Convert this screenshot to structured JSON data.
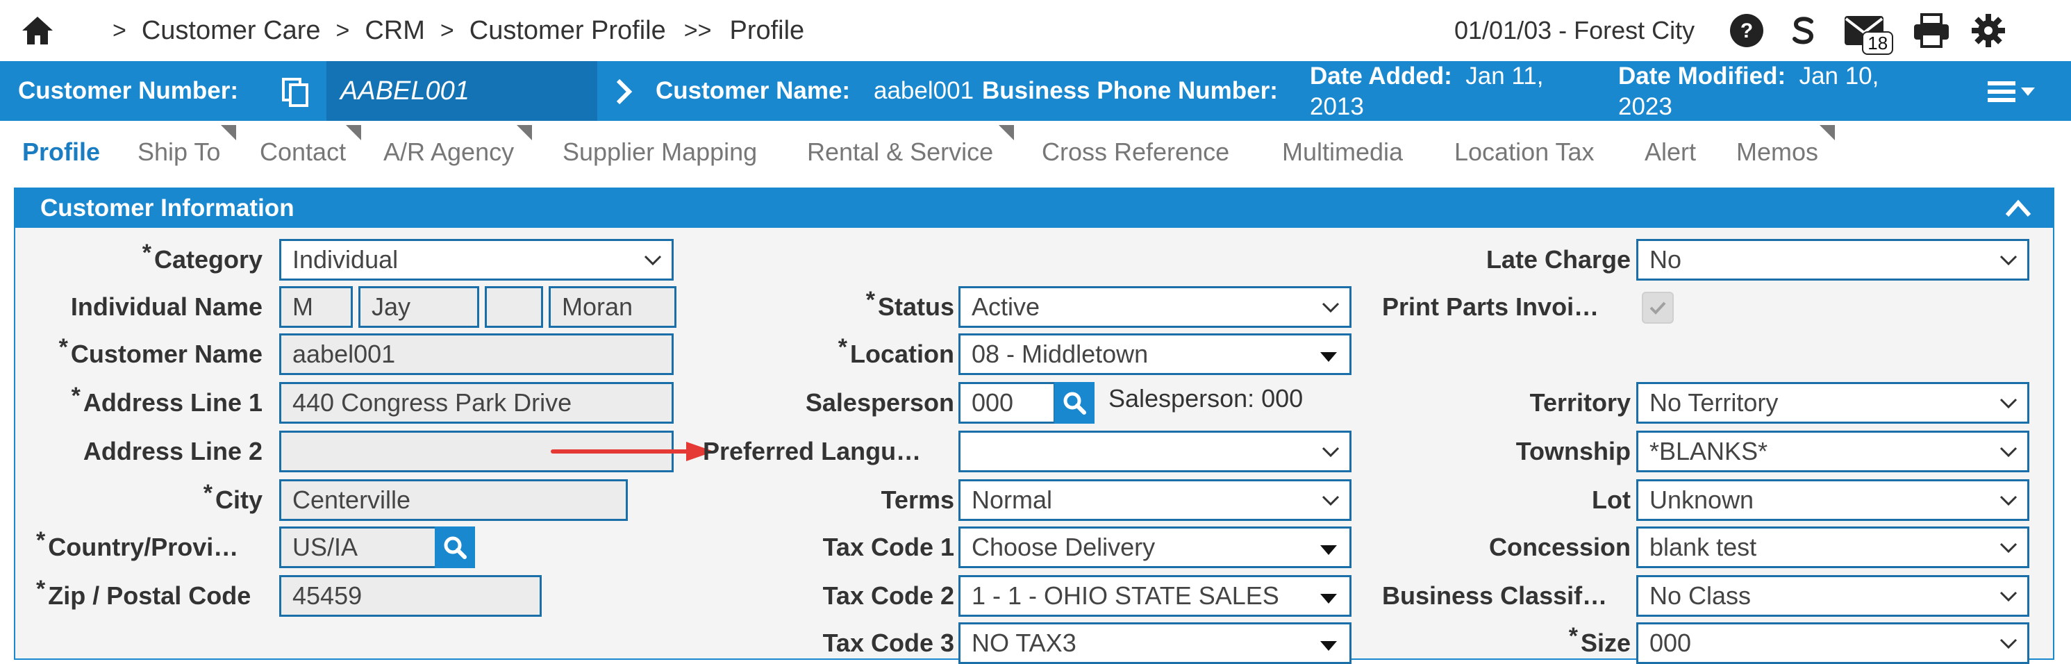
{
  "breadcrumb": {
    "items": [
      "Customer Care",
      "CRM",
      "Customer Profile",
      "Profile"
    ],
    "separators": [
      ">",
      ">",
      ">",
      ">>"
    ]
  },
  "header": {
    "date_location": "01/01/03 - Forest City",
    "mail_count": "18"
  },
  "band": {
    "customer_number_label": "Customer Number:",
    "customer_number_value": "AABEL001",
    "customer_name_label": "Customer Name:",
    "customer_name_value": "aabel001",
    "business_phone_label": "Business Phone Number:",
    "date_added_label": "Date Added:",
    "date_added_line1": "Jan 11,",
    "date_added_line2": "2013",
    "date_modified_label": "Date Modified:",
    "date_modified_line1": "Jan 10,",
    "date_modified_line2": "2023"
  },
  "tabs": [
    "Profile",
    "Ship To",
    "Contact",
    "A/R Agency",
    "Supplier Mapping",
    "Rental & Service",
    "Cross Reference",
    "Multimedia",
    "Location Tax",
    "Alert",
    "Memos"
  ],
  "panel": {
    "title": "Customer Information"
  },
  "left": {
    "category_label": "Category",
    "category_value": "Individual",
    "individual_name_label": "Individual Name",
    "name_parts": [
      "M",
      "Jay",
      "",
      "Moran"
    ],
    "customer_name_label": "Customer Name",
    "customer_name_value": "aabel001",
    "address1_label": "Address Line 1",
    "address1_value": "440 Congress Park Drive",
    "address2_label": "Address Line 2",
    "address2_value": "",
    "city_label": "City",
    "city_value": "Centerville",
    "country_label": "Country/Provi…",
    "country_value": "US/IA",
    "zip_label": "Zip / Postal Code",
    "zip_value": "45459"
  },
  "middle": {
    "status_label": "Status",
    "status_value": "Active",
    "location_label": "Location",
    "location_value": "08 - Middletown",
    "salesperson_label": "Salesperson",
    "salesperson_value": "000",
    "salesperson_text": "Salesperson: 000",
    "pref_lang_label": "Preferred Langu…",
    "pref_lang_value": "",
    "terms_label": "Terms",
    "terms_value": "Normal",
    "tax1_label": "Tax Code 1",
    "tax1_value": "Choose Delivery",
    "tax2_label": "Tax Code 2",
    "tax2_value": "1 - 1 - OHIO STATE SALES",
    "tax3_label": "Tax Code 3",
    "tax3_value": "NO TAX3"
  },
  "right": {
    "late_charge_label": "Late Charge",
    "late_charge_value": "No",
    "print_parts_label": "Print Parts Invoi…",
    "print_parts_checked": true,
    "territory_label": "Territory",
    "territory_value": "No Territory",
    "township_label": "Township",
    "township_value": "*BLANKS*",
    "lot_label": "Lot",
    "lot_value": "Unknown",
    "concession_label": "Concession",
    "concession_value": "blank test",
    "business_class_label": "Business Classif…",
    "business_class_value": "No Class",
    "size_label": "Size",
    "size_value": "000"
  },
  "colors": {
    "accent": "#1a88cf",
    "annotation_arrow": "#e53935"
  }
}
